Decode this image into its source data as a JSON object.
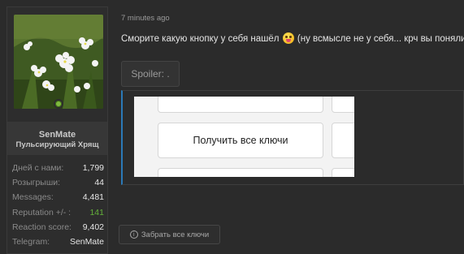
{
  "user": {
    "name": "SenMate",
    "title": "Пульсирующий Хрящ",
    "online": true,
    "stats": [
      {
        "label": "Дней с нами:",
        "value": "1,799"
      },
      {
        "label": "Розыгрыши:",
        "value": "44"
      },
      {
        "label": "Messages:",
        "value": "4,481"
      },
      {
        "label": "Reputation +/- :",
        "value": "141"
      },
      {
        "label": "Reaction score:",
        "value": "9,402"
      },
      {
        "label": "Telegram:",
        "value": "SenMate"
      }
    ]
  },
  "message": {
    "timestamp": "7 minutes ago",
    "text_before": "Сморите какую кнопку у себя нашёл",
    "emoji": "stuck-out-tongue-emoji",
    "text_after": "(ну всмысле не у себя... крч вы поняли)",
    "spoiler_label": "Spoiler: .",
    "screenshot": {
      "main_button_label": "Получить все ключи"
    }
  },
  "actions": {
    "collect_label": "Забрать все ключи"
  },
  "colors": {
    "background": "#2b2b2b",
    "accent_border": "#2b79b7",
    "reputation_green": "#63b03a",
    "online": "#7fba3f"
  }
}
